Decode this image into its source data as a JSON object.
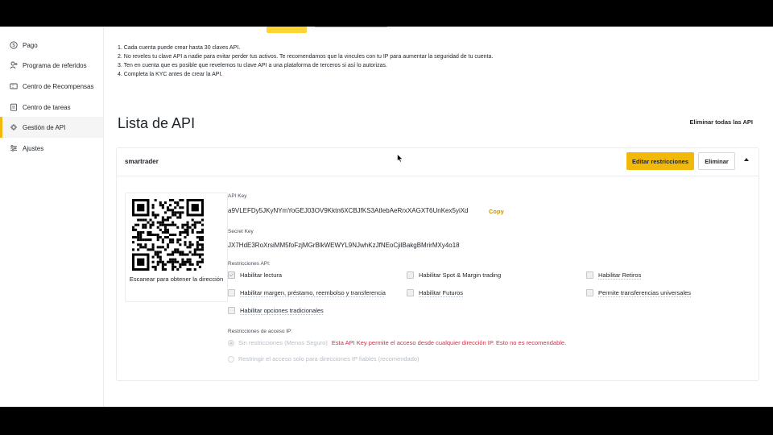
{
  "sidebar": {
    "items": [
      {
        "label": "Pago",
        "icon": "dollar-circle-icon"
      },
      {
        "label": "Programa de referidos",
        "icon": "user-plus-icon"
      },
      {
        "label": "Centro de Recompensas",
        "icon": "ticket-icon"
      },
      {
        "label": "Centro de tareas",
        "icon": "clipboard-icon"
      },
      {
        "label": "Gestión de API",
        "icon": "api-icon",
        "active": true
      },
      {
        "label": "Ajustes",
        "icon": "sliders-icon"
      }
    ]
  },
  "notes": [
    "1. Cada cuenta puede crear hasta 30 claves API.",
    "2. No reveles tu clave API a nadie para evitar perder tus activos. Te recomendamos que la vincules con tu IP para aumentar la seguridad de tu cuenta.",
    "3. Ten en cuenta que es posible que revelemos tu clave API a una plataforma de terceros si así lo autorizas.",
    "4. Completa la KYC antes de crear la API."
  ],
  "list": {
    "title": "Lista de API",
    "delete_all_label": "Eliminar todas las API"
  },
  "api": {
    "name": "smartrader",
    "edit_label": "Editar restricciones",
    "delete_label": "Eliminar",
    "qr_caption": "Escanear para obtener la dirección",
    "api_key_label": "API Key",
    "api_key": "a9VLEFDy5JKyNYmYoGEJ03OV9Kktn6XCBJfKS3AtIebAeRrxXAGXT6UnKex5yiXd",
    "copy_label": "Copy",
    "secret_key_label": "Secret Key",
    "secret_key": "JX7HdE3RoXrsiMM5foFzjMGrBlkWEWYL9NJwhKzJfNEoCjilBakgBMrirMXy4o18",
    "restrictions_label": "Restricciones API:",
    "restrictions": [
      {
        "label": "Habilitar lectura",
        "checked": true
      },
      {
        "label": "Habilitar Spot & Margin trading",
        "checked": false
      },
      {
        "label": "Habilitar Retiros",
        "checked": false
      },
      {
        "label": "Habilitar margen, préstamo, reembolso y transferencia",
        "checked": false
      },
      {
        "label": "Habilitar Futuros",
        "checked": false
      },
      {
        "label": "Permite transferencias universales",
        "checked": false
      },
      {
        "label": "Habilitar opciones tradicionales",
        "checked": false
      }
    ],
    "ip_label": "Restricciones de acceso IP:",
    "ip_unrestricted": "Sin restricciones (Menos Seguro)",
    "ip_warning": "Esta API Key permite el acceso desde cualquier dirección IP. Esto no es recomendable.",
    "ip_restricted": "Restringir el acceso solo para direcciones IP fiables (recomendado)"
  },
  "colors": {
    "accent": "#f0b90b",
    "warning": "#cf304a",
    "copy": "#c99400"
  }
}
